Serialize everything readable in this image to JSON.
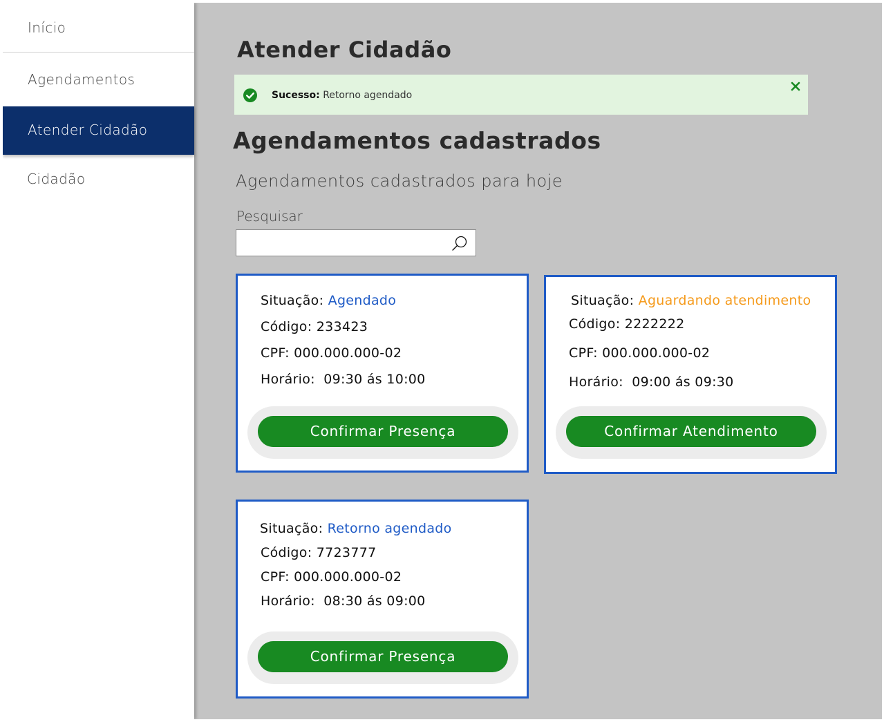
{
  "sidebar": {
    "items": [
      {
        "label": "Início"
      },
      {
        "label": "Agendamentos"
      },
      {
        "label": "Atender Cidadão"
      },
      {
        "label": "Cidadão"
      }
    ]
  },
  "main": {
    "title": "Atender Cidadão",
    "alert": {
      "type_label": "Sucesso:",
      "message": "Retorno agendado"
    },
    "section_title": "Agendamentos cadastrados",
    "section_subtitle": "Agendamentos cadastrados para hoje",
    "search": {
      "label": "Pesquisar",
      "value": "",
      "placeholder": ""
    },
    "cards": [
      {
        "situacao_label": "Situação:",
        "situacao_value": "Agendado",
        "codigo_label": "Código:",
        "codigo_value": "233423",
        "cpf_label": "CPF:",
        "cpf_value": "000.000.000-02",
        "horario_label": "Horário:",
        "horario_value": "09:30 ás 10:00",
        "button_label": "Confirmar Presença"
      },
      {
        "situacao_label": "Situação:",
        "situacao_value": "Aguardando atendimento",
        "codigo_label": "Código:",
        "codigo_value": "2222222",
        "cpf_label": "CPF:",
        "cpf_value": "000.000.000-02",
        "horario_label": "Horário:",
        "horario_value": "09:00 ás 09:30",
        "button_label": "Confirmar Atendimento"
      },
      {
        "situacao_label": "Situação:",
        "situacao_value": "Retorno agendado",
        "codigo_label": "Código:",
        "codigo_value": "7723777",
        "cpf_label": "CPF:",
        "cpf_value": "000.000.000-02",
        "horario_label": "Horário:",
        "horario_value": "08:30 ás 09:00",
        "button_label": "Confirmar Presença"
      }
    ]
  },
  "colors": {
    "sidebar_active": "#0c2f6b",
    "card_border": "#1f5bc6",
    "status_blue": "#1f5bc6",
    "status_orange": "#f59a1b",
    "button_green": "#188a22",
    "alert_bg": "#e2f4df",
    "success_green": "#188a22"
  }
}
